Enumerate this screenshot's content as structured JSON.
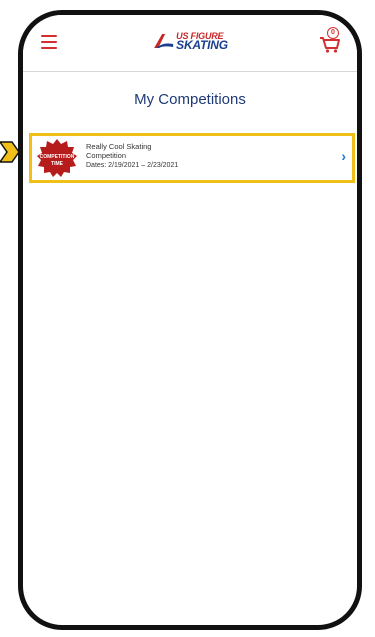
{
  "header": {
    "logo_top": "US FIGURE",
    "logo_bottom": "SKATING",
    "cart_count": "0",
    "icons": {
      "menu": "hamburger-menu-icon",
      "cart": "shopping-cart-icon",
      "chevron": "chevron-right-icon"
    }
  },
  "page": {
    "title": "My Competitions"
  },
  "competition": {
    "badge_text": "COMPETITION TIME",
    "name_line1": "Really Cool Skating",
    "name_line2": "Competition",
    "dates": "Dates: 2/19/2021 – 2/23/2021"
  },
  "colors": {
    "accent_red": "#d32f2f",
    "brand_blue": "#1e3a78",
    "highlight": "#f0c018",
    "chevron_blue": "#1976d2"
  }
}
